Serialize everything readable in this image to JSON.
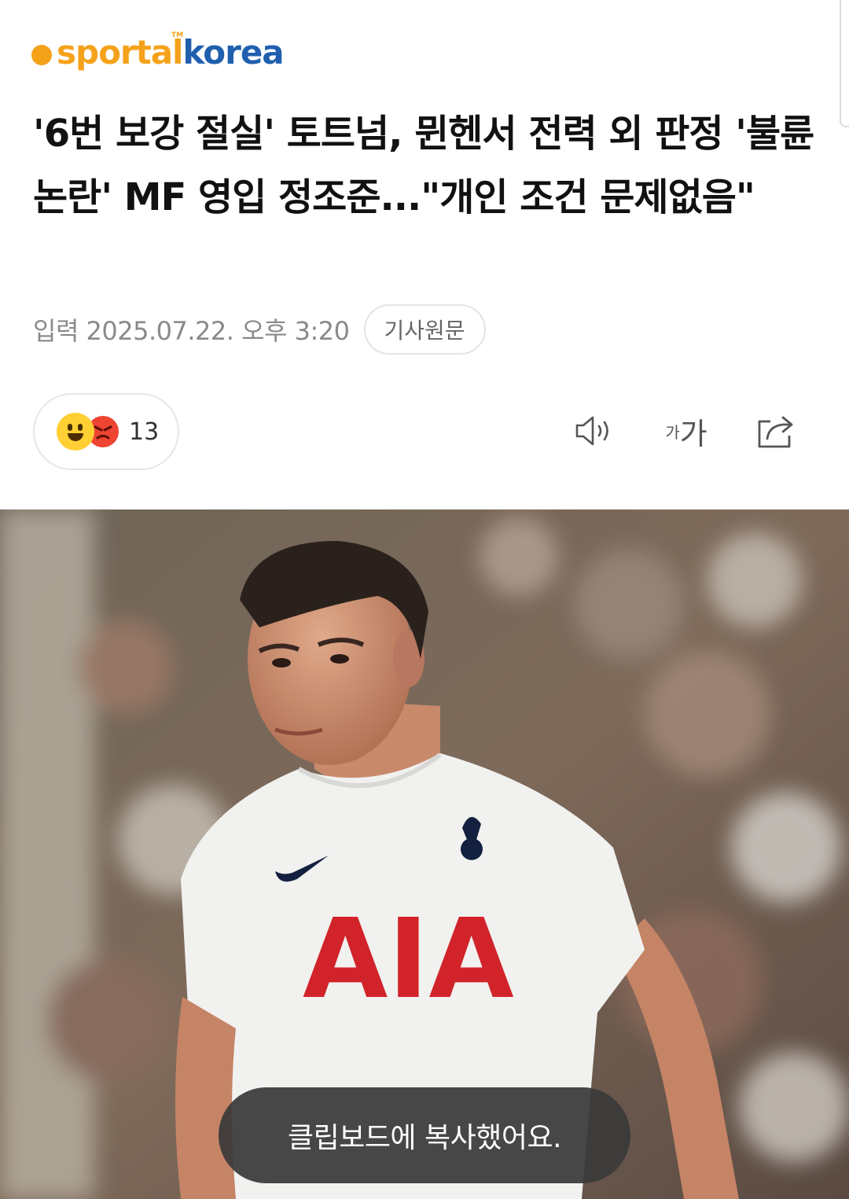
{
  "logo": {
    "part1": "sportal",
    "part2": "korea",
    "tm": "TM"
  },
  "article": {
    "title": "'6번 보강 절실' 토트넘, 뮌헨서 전력 외 판정 '불륜 논란' MF 영입 정조준...\"개인 조건 문제없음\"",
    "date": "입력 2025.07.22. 오후 3:20",
    "source_button": "기사원문"
  },
  "reactions": {
    "count": "13",
    "icons": [
      "happy-emoji-icon",
      "angry-emoji-icon"
    ]
  },
  "toolbar": {
    "font_small": "가",
    "font_large": "가",
    "icons": [
      "speaker-icon",
      "font-size-icon",
      "share-icon"
    ]
  },
  "photo": {
    "jersey_text": "AIA"
  },
  "toast": {
    "message": "클립보드에 복사했어요."
  },
  "colors": {
    "logo_orange": "#f5a21b",
    "logo_blue": "#1f5fae",
    "jersey_red": "#d2232a",
    "toast_bg": "#3a3a3a"
  }
}
